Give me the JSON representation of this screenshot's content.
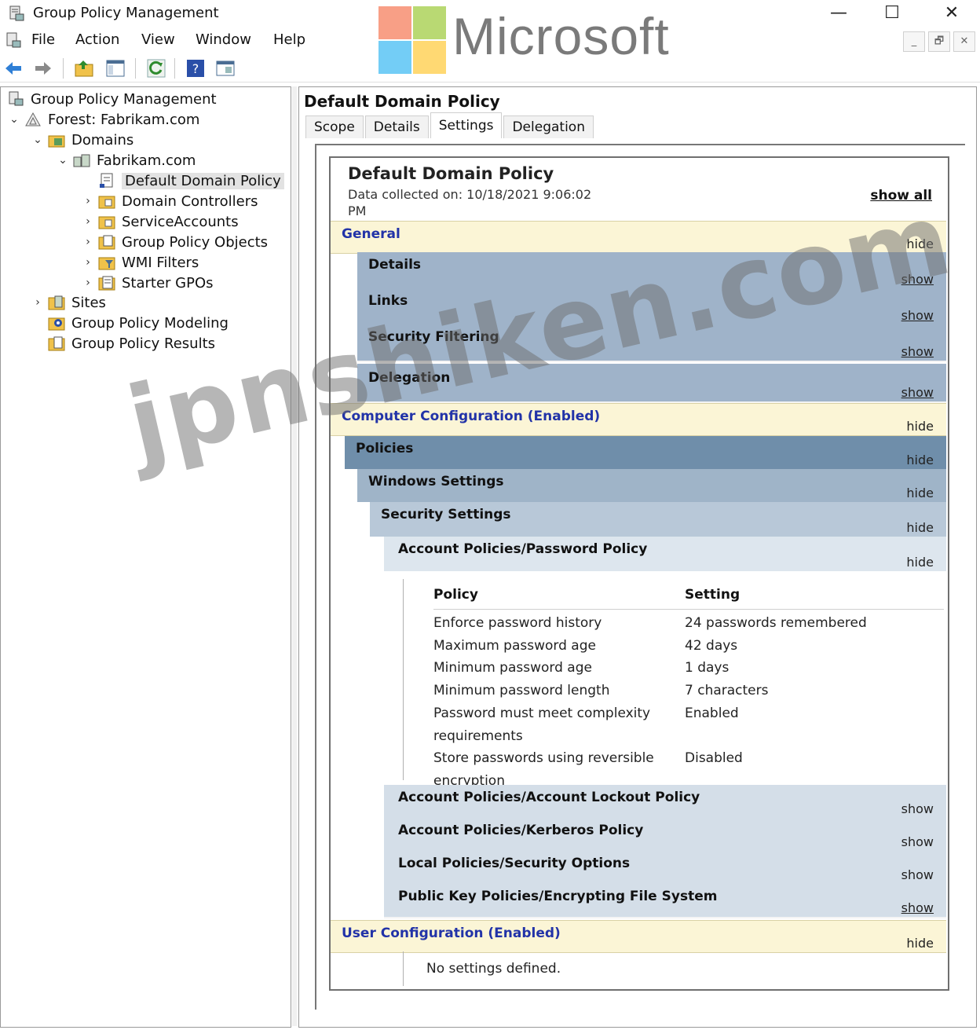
{
  "window": {
    "title": "Group Policy Management",
    "controls": {
      "minimize": "—",
      "maximize": "☐",
      "close": "✕"
    }
  },
  "brand": {
    "text": "Microsoft",
    "colors": [
      "#f25022",
      "#7fba00",
      "#00a4ef",
      "#ffb900"
    ]
  },
  "menu": {
    "items": [
      "File",
      "Action",
      "View",
      "Window",
      "Help"
    ]
  },
  "mdi": {
    "minimize": "_",
    "restore": "🗗",
    "close": "✕"
  },
  "toolbar": {
    "icons": [
      "back-arrow-icon",
      "forward-arrow-icon",
      "up-folder-icon",
      "show-hide-console-tree-icon",
      "refresh-icon",
      "help-icon",
      "properties-icon"
    ]
  },
  "tree": {
    "root": "Group Policy Management",
    "forest": "Forest: Fabrikam.com",
    "domains": "Domains",
    "domain": "Fabrikam.com",
    "items": [
      "Default Domain Policy",
      "Domain Controllers",
      "ServiceAccounts",
      "Group Policy Objects",
      "WMI Filters",
      "Starter GPOs"
    ],
    "sites": "Sites",
    "modeling": "Group Policy Modeling",
    "results": "Group Policy Results"
  },
  "right": {
    "title": "Default Domain Policy",
    "tabs": [
      "Scope",
      "Details",
      "Settings",
      "Delegation"
    ],
    "active_tab": "Settings"
  },
  "report": {
    "title": "Default Domain Policy",
    "date_collected": "Data collected on: 10/18/2021 9:06:02 PM",
    "show_all": "show all",
    "general": {
      "label": "General",
      "toggle": "hide"
    },
    "general_items": [
      {
        "label": "Details",
        "toggle": "show"
      },
      {
        "label": "Links",
        "toggle": "show"
      },
      {
        "label": "Security Filtering",
        "toggle": "show"
      },
      {
        "label": "Delegation",
        "toggle": "show"
      }
    ],
    "computer": {
      "label": "Computer Configuration (Enabled)",
      "toggle": "hide"
    },
    "policies": {
      "label": "Policies",
      "toggle": "hide"
    },
    "windows_settings": {
      "label": "Windows Settings",
      "toggle": "hide"
    },
    "security_settings": {
      "label": "Security Settings",
      "toggle": "hide"
    },
    "password_policy": {
      "label": "Account Policies/Password Policy",
      "toggle": "hide"
    },
    "table": {
      "headers": [
        "Policy",
        "Setting"
      ],
      "rows": [
        {
          "policy": "Enforce password history",
          "setting": "24 passwords remembered"
        },
        {
          "policy": "Maximum password age",
          "setting": "42 days"
        },
        {
          "policy": "Minimum password age",
          "setting": "1 days"
        },
        {
          "policy": "Minimum password length",
          "setting": "7 characters"
        },
        {
          "policy": "Password must meet complexity requirements",
          "setting": "Enabled"
        },
        {
          "policy": "Store passwords using reversible encryption",
          "setting": "Disabled"
        }
      ]
    },
    "other_policies": [
      {
        "label": "Account Policies/Account Lockout Policy",
        "toggle": "show"
      },
      {
        "label": "Account Policies/Kerberos Policy",
        "toggle": "show"
      },
      {
        "label": "Local Policies/Security Options",
        "toggle": "show"
      },
      {
        "label": "Public Key Policies/Encrypting File System",
        "toggle": "show"
      }
    ],
    "user": {
      "label": "User Configuration (Enabled)",
      "toggle": "hide"
    },
    "no_settings": "No settings defined."
  },
  "watermark": "jpnshiken.com"
}
